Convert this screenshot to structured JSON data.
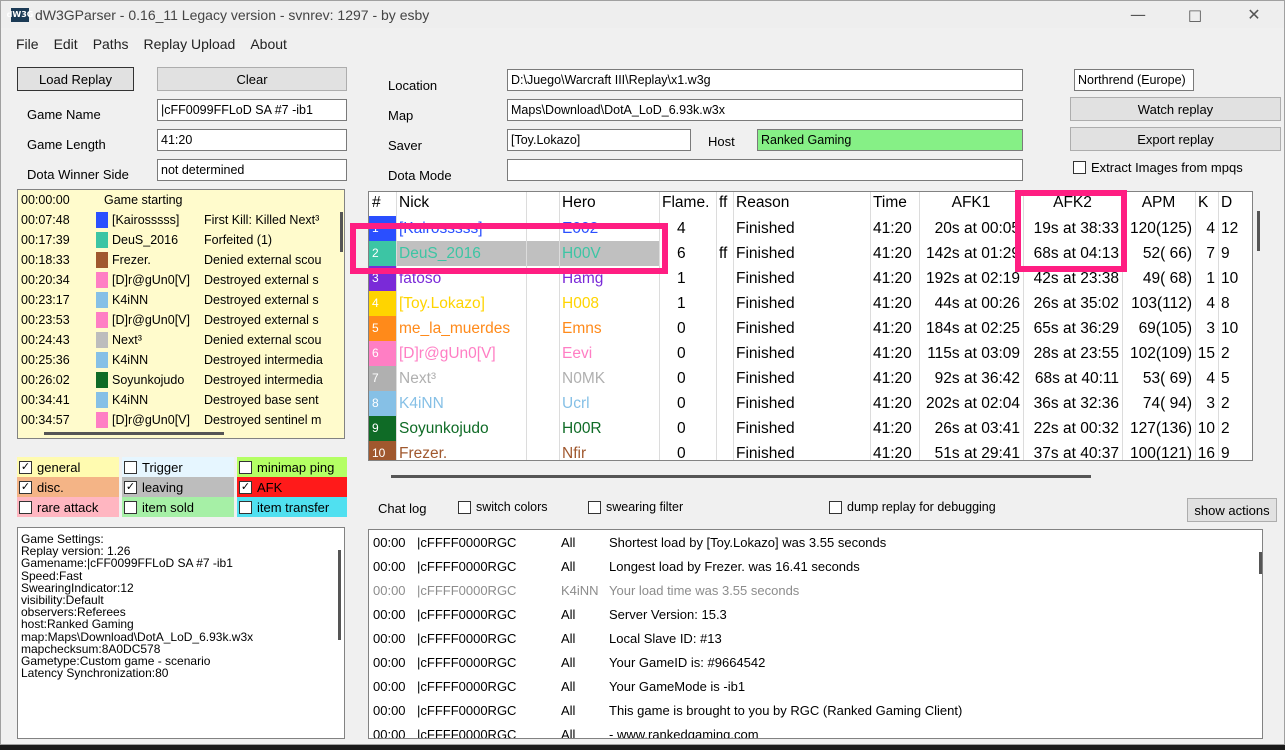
{
  "window": {
    "title": "dW3GParser - 0.16_11 Legacy version - svnrev: 1297 - by esby",
    "icon_text": "dW3G"
  },
  "menu": [
    "File",
    "Edit",
    "Paths",
    "Replay Upload",
    "About"
  ],
  "buttons": {
    "load_replay": "Load Replay",
    "clear": "Clear",
    "watch_replay": "Watch replay",
    "export_replay": "Export replay",
    "show_actions": "show actions"
  },
  "game": {
    "name_label": "Game Name",
    "name": "|cFF0099FFLoD SA #7 -ib1",
    "length_label": "Game Length",
    "length": "41:20",
    "winner_label": "Dota Winner Side",
    "winner": "not determined"
  },
  "replay": {
    "location_label": "Location",
    "location": "D:\\Juego\\Warcraft III\\Replay\\x1.w3g",
    "map_label": "Map",
    "map": "Maps\\Download\\DotA_LoD_6.93k.w3x",
    "saver_label": "Saver",
    "saver": "[Toy.Lokazo]",
    "host_label": "Host",
    "host": "Ranked Gaming",
    "mode_label": "Dota Mode",
    "mode": "",
    "region": "Northrend (Europe)",
    "extract_label": "Extract Images from mpqs"
  },
  "events": [
    {
      "time": "00:00:00",
      "name": "Game starting",
      "text": "",
      "color": ""
    },
    {
      "time": "00:07:48",
      "name": "[Kairosssss]",
      "text": "First Kill: Killed Next³",
      "color": "#2a4fff"
    },
    {
      "time": "00:17:39",
      "name": "DeuS_2016",
      "text": "Forfeited (1)",
      "color": "#3cc5a4"
    },
    {
      "time": "00:18:33",
      "name": "Frezer.",
      "text": "Denied external scou",
      "color": "#a0582e"
    },
    {
      "time": "00:20:34",
      "name": "[D]r@gUn0[V]",
      "text": "Destroyed external s",
      "color": "#ff7ec4"
    },
    {
      "time": "00:23:17",
      "name": "K4iNN",
      "text": "Destroyed external s",
      "color": "#86c0e6"
    },
    {
      "time": "00:23:53",
      "name": "[D]r@gUn0[V]",
      "text": "Destroyed external s",
      "color": "#ff7ec4"
    },
    {
      "time": "00:24:43",
      "name": "Next³",
      "text": "Denied external scou",
      "color": "#bdbdbd"
    },
    {
      "time": "00:25:36",
      "name": "K4iNN",
      "text": "Destroyed intermedia",
      "color": "#86c0e6"
    },
    {
      "time": "00:26:02",
      "name": "Soyunkojudo",
      "text": "Destroyed intermedia",
      "color": "#0f6b26"
    },
    {
      "time": "00:34:41",
      "name": "K4iNN",
      "text": "Destroyed base sent",
      "color": "#86c0e6"
    },
    {
      "time": "00:34:57",
      "name": "[D]r@gUn0[V]",
      "text": "Destroyed sentinel m",
      "color": "#ff7ec4"
    }
  ],
  "filters": [
    {
      "label": "general",
      "checked": true,
      "bg": "#fffbb0"
    },
    {
      "label": "Trigger",
      "checked": false,
      "bg": "#e6f6ff"
    },
    {
      "label": "minimap ping",
      "checked": false,
      "bg": "#b4ff64"
    },
    {
      "label": "disc.",
      "checked": true,
      "bg": "#f4b486"
    },
    {
      "label": "leaving",
      "checked": true,
      "bg": "#bdbdbd"
    },
    {
      "label": "AFK",
      "checked": true,
      "bg": "#ff1a1a"
    },
    {
      "label": "rare attack",
      "checked": false,
      "bg": "#ffb6c1"
    },
    {
      "label": "item sold",
      "checked": false,
      "bg": "#a6f0a6"
    },
    {
      "label": "item transfer",
      "checked": false,
      "bg": "#50e0f0"
    }
  ],
  "game_info": [
    "Game Settings:",
    "Replay version: 1.26",
    "Gamename:|cFF0099FFLoD SA #7 -ib1",
    "Speed:Fast",
    "SwearingIndicator:12",
    "visibility:Default",
    "observers:Referees",
    "host:Ranked Gaming",
    "map:Maps\\Download\\DotA_LoD_6.93k.w3x",
    "mapchecksum:8A0DC578",
    "Gametype:Custom game - scenario",
    "Latency Synchronization:80"
  ],
  "players_header": [
    "#",
    "Nick",
    "",
    "Hero",
    "Flame.",
    "ff",
    "Reason",
    "Time",
    "AFK1",
    "AFK2",
    "APM",
    "K",
    "D"
  ],
  "players": [
    {
      "n": "1",
      "nick": "[Kairosssss]",
      "hero": "E002",
      "flame": "4",
      "ff": "",
      "reason": "Finished",
      "time": "41:20",
      "afk1": "20s at 00:05",
      "afk2": "19s at 38:33",
      "apm": "120(125)",
      "k": "4",
      "d": "12",
      "color": "#2a4fff",
      "bg": "#ffffff"
    },
    {
      "n": "2",
      "nick": "DeuS_2016",
      "hero": "H00V",
      "flame": "6",
      "ff": "ff",
      "reason": "Finished",
      "time": "41:20",
      "afk1": "142s at 01:29",
      "afk2": "68s at 04:13",
      "apm": "52( 66)",
      "k": "7",
      "d": "9",
      "color": "#3cc5a4",
      "bg": "#c0c0c0"
    },
    {
      "n": "3",
      "nick": "fatoso",
      "hero": "Hamg",
      "flame": "1",
      "ff": "",
      "reason": "Finished",
      "time": "41:20",
      "afk1": "192s at 02:19",
      "afk2": "42s at 23:38",
      "apm": "49( 68)",
      "k": "1",
      "d": "10",
      "color": "#7a2ad8",
      "bg": "#ffffff"
    },
    {
      "n": "4",
      "nick": "[Toy.Lokazo]",
      "hero": "H008",
      "flame": "1",
      "ff": "",
      "reason": "Finished",
      "time": "41:20",
      "afk1": "44s at 00:26",
      "afk2": "26s at 35:02",
      "apm": "103(112)",
      "k": "4",
      "d": "8",
      "color": "#ffd400",
      "bg": "#ffffff"
    },
    {
      "n": "5",
      "nick": "me_la_muerdes",
      "hero": "Emns",
      "flame": "0",
      "ff": "",
      "reason": "Finished",
      "time": "41:20",
      "afk1": "184s at 02:25",
      "afk2": "65s at 36:29",
      "apm": "69(105)",
      "k": "3",
      "d": "10",
      "color": "#ff8a1a",
      "bg": "#ffffff"
    },
    {
      "n": "6",
      "nick": "[D]r@gUn0[V]",
      "hero": "Eevi",
      "flame": "0",
      "ff": "",
      "reason": "Finished",
      "time": "41:20",
      "afk1": "115s at 03:09",
      "afk2": "28s at 23:55",
      "apm": "102(109)",
      "k": "15",
      "d": "2",
      "color": "#ff7ec4",
      "bg": "#ffffff"
    },
    {
      "n": "7",
      "nick": "Next³",
      "hero": "N0MK",
      "flame": "0",
      "ff": "",
      "reason": "Finished",
      "time": "41:20",
      "afk1": "92s at 36:42",
      "afk2": "68s at 40:11",
      "apm": "53( 69)",
      "k": "4",
      "d": "5",
      "color": "#b0b0b0",
      "bg": "#ffffff"
    },
    {
      "n": "8",
      "nick": "K4iNN",
      "hero": "Ucrl",
      "flame": "0",
      "ff": "",
      "reason": "Finished",
      "time": "41:20",
      "afk1": "202s at 02:04",
      "afk2": "36s at 32:36",
      "apm": "74( 94)",
      "k": "3",
      "d": "2",
      "color": "#86c0e6",
      "bg": "#ffffff"
    },
    {
      "n": "9",
      "nick": "Soyunkojudo",
      "hero": "H00R",
      "flame": "0",
      "ff": "",
      "reason": "Finished",
      "time": "41:20",
      "afk1": "26s at 03:41",
      "afk2": "22s at 00:32",
      "apm": "127(136)",
      "k": "10",
      "d": "2",
      "color": "#0f6b26",
      "bg": "#ffffff"
    },
    {
      "n": "10",
      "nick": "Frezer.",
      "hero": "Nfir",
      "flame": "0",
      "ff": "",
      "reason": "Finished",
      "time": "41:20",
      "afk1": "51s at 29:41",
      "afk2": "37s at 40:37",
      "apm": "100(121)",
      "k": "16",
      "d": "9",
      "color": "#a0582e",
      "bg": "#ffffff"
    }
  ],
  "chat_options": {
    "label": "Chat log",
    "switch_colors": "switch colors",
    "swearing_filter": "swearing filter",
    "dump": "dump replay for debugging"
  },
  "chat": [
    {
      "time": "00:00",
      "who": "|cFFFF0000RGC",
      "to": "All",
      "msg": "Shortest load by [Toy.Lokazo] was 3.55 seconds",
      "color": "#000000"
    },
    {
      "time": "00:00",
      "who": "|cFFFF0000RGC",
      "to": "All",
      "msg": "Longest load by Frezer. was 16.41 seconds",
      "color": "#000000"
    },
    {
      "time": "00:00",
      "who": "|cFFFF0000RGC",
      "to": "K4iNN",
      "msg": "Your load time was 3.55 seconds",
      "color": "#8c8c8c"
    },
    {
      "time": "00:00",
      "who": "|cFFFF0000RGC",
      "to": "All",
      "msg": "Server Version: 15.3",
      "color": "#000000"
    },
    {
      "time": "00:00",
      "who": "|cFFFF0000RGC",
      "to": "All",
      "msg": "Local Slave ID: #13",
      "color": "#000000"
    },
    {
      "time": "00:00",
      "who": "|cFFFF0000RGC",
      "to": "All",
      "msg": "Your GameID is: #9664542",
      "color": "#000000"
    },
    {
      "time": "00:00",
      "who": "|cFFFF0000RGC",
      "to": "All",
      "msg": "Your GameMode is -ib1",
      "color": "#000000"
    },
    {
      "time": "00:00",
      "who": "|cFFFF0000RGC",
      "to": "All",
      "msg": "This game is brought to you by RGC (Ranked Gaming Client)",
      "color": "#000000"
    },
    {
      "time": "00:00",
      "who": "|cFFFF0000RGC",
      "to": "All",
      "msg": "- www.rankedgaming.com",
      "color": "#000000"
    }
  ],
  "colors": {
    "highlight": "#ff1e82",
    "host_bg": "#86f086"
  }
}
